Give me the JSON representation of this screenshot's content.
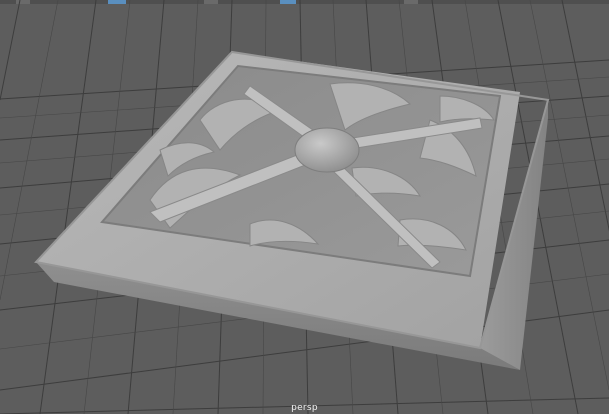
{
  "viewport": {
    "camera_label": "persp",
    "background_color": "#5d5d5d",
    "grid_color": "#3c3c3c",
    "model_color": "#a8a8a8"
  },
  "toolbar": {
    "buttons": [
      {
        "name": "tool-button-1",
        "active": false
      },
      {
        "name": "tool-button-2",
        "active": true
      },
      {
        "name": "tool-button-3",
        "active": false
      },
      {
        "name": "tool-button-4",
        "active": true
      },
      {
        "name": "tool-button-5",
        "active": false
      }
    ]
  }
}
